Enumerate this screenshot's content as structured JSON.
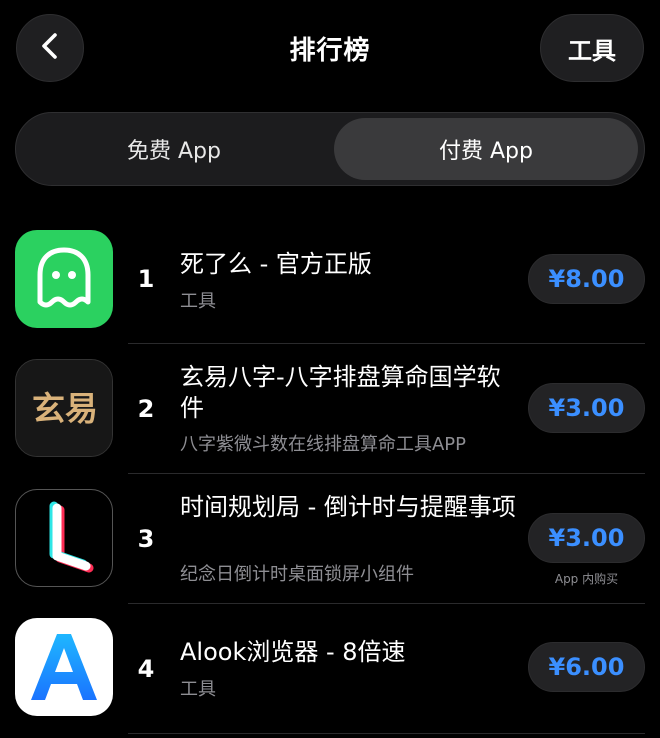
{
  "header": {
    "back_icon": "chevron-left-icon",
    "title": "排行榜",
    "tools_label": "工具"
  },
  "segments": {
    "free_label": "免费 App",
    "paid_label": "付费 App",
    "selected": "paid"
  },
  "apps": [
    {
      "rank": "1",
      "name": "死了么 - 官方正版",
      "subtitle": "工具",
      "price": "¥8.00",
      "icon": "ghost-icon",
      "icon_color": "#2bd160"
    },
    {
      "rank": "2",
      "name": "玄易八字-八字排盘算命国学软件",
      "subtitle": "八字紫微斗数在线排盘算命工具APP",
      "price": "¥3.00",
      "icon": "xuanyi-logo",
      "icon_text": "玄易",
      "icon_color": "#1b1b1b"
    },
    {
      "rank": "3",
      "name": "时间规划局 - 倒计时与提醒事项",
      "subtitle": "纪念日倒计时桌面锁屏小组件",
      "price": "¥3.00",
      "in_app_purchase": "App 内购买",
      "icon": "countdown-l-icon",
      "icon_color": "#000000"
    },
    {
      "rank": "4",
      "name": "Alook浏览器 - 8倍速",
      "subtitle": "工具",
      "price": "¥6.00",
      "icon": "alook-a-icon",
      "icon_color": "#ffffff"
    }
  ],
  "colors": {
    "background": "#000000",
    "price_text": "#3b8fff",
    "subtitle_text": "#8e8e93"
  }
}
